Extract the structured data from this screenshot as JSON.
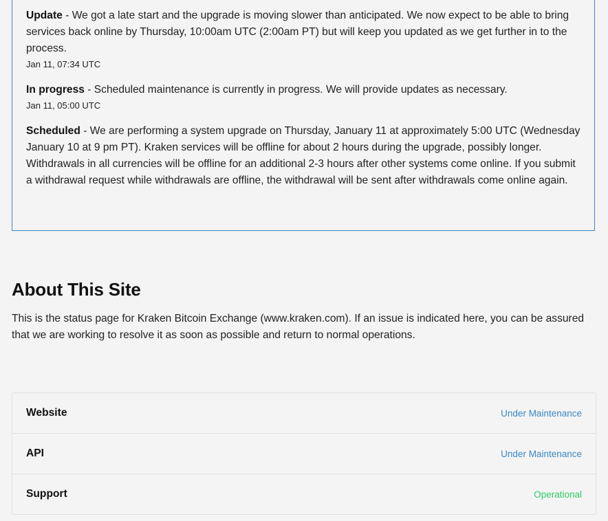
{
  "incident": {
    "updates": [
      {
        "status": "Update",
        "separator": " - ",
        "message": "We got a late start and the upgrade is moving slower than anticipated. We now expect to be able to bring services back online by Thursday, 10:00am UTC (2:00am PT) but will keep you updated as we get further in to the process.",
        "timestamp": "Jan 11, 07:34 UTC"
      },
      {
        "status": "In progress",
        "separator": " - ",
        "message": "Scheduled maintenance is currently in progress. We will provide updates as necessary.",
        "timestamp": "Jan 11, 05:00 UTC"
      },
      {
        "status": "Scheduled",
        "separator": " - ",
        "message": "We are performing a system upgrade on Thursday, January 11 at approximately 5:00 UTC (Wednesday January 10 at 9 pm PT). Kraken services will be offline for about 2 hours during the upgrade, possibly longer. Withdrawals in all currencies will be offline for an additional 2-3 hours after other systems come online. If you submit a withdrawal request while withdrawals are offline, the withdrawal will be sent after withdrawals come online again.",
        "timestamp": ""
      }
    ],
    "border_color": "#3b88c3"
  },
  "about": {
    "title": "About This Site",
    "text": "This is the status page for Kraken Bitcoin Exchange (www.kraken.com). If an issue is indicated here, you can be assured that we are working to resolve it as soon as possible and return to normal operations."
  },
  "components": [
    {
      "name": "Website",
      "status": "Under Maintenance",
      "status_color": "#3b88c3"
    },
    {
      "name": "API",
      "status": "Under Maintenance",
      "status_color": "#3b88c3"
    },
    {
      "name": "Support",
      "status": "Operational",
      "status_color": "#2fcc66"
    }
  ]
}
